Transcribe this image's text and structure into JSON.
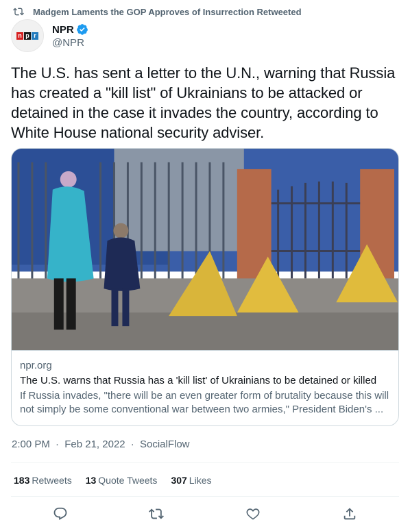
{
  "retweet": {
    "label": "Madgem Laments the GOP Approves of Insurrection Retweeted",
    "icon": "retweet-icon"
  },
  "author": {
    "display_name": "NPR",
    "handle": "@NPR",
    "verified": true,
    "avatar_letters": [
      "n",
      "p",
      "r"
    ],
    "colors": {
      "n": "#d62021",
      "p": "#1a1a1a",
      "r": "#237bbd",
      "verified": "#1d9bf0"
    }
  },
  "tweet": {
    "text": "The U.S. has sent a letter to the U.N., warning that Russia has created a \"kill list\" of Ukrainians to be attacked or detained in the case it invades the country, according to White House national security adviser."
  },
  "card": {
    "domain": "npr.org",
    "title": "The U.S. warns that Russia has a 'kill list' of Ukrainians to be detained or killed",
    "description": "If Russia invades, \"there will be an even greater form of brutality because this will not simply be some conventional war between two armies,\" President Biden's ..."
  },
  "meta": {
    "time": "2:00 PM",
    "date": "Feb 21, 2022",
    "source": "SocialFlow",
    "separator": "·"
  },
  "stats": {
    "retweets_count": "183",
    "retweets_label": "Retweets",
    "quotes_count": "13",
    "quotes_label": "Quote Tweets",
    "likes_count": "307",
    "likes_label": "Likes"
  },
  "actions": [
    "reply-icon",
    "retweet-icon",
    "like-icon",
    "share-icon"
  ]
}
